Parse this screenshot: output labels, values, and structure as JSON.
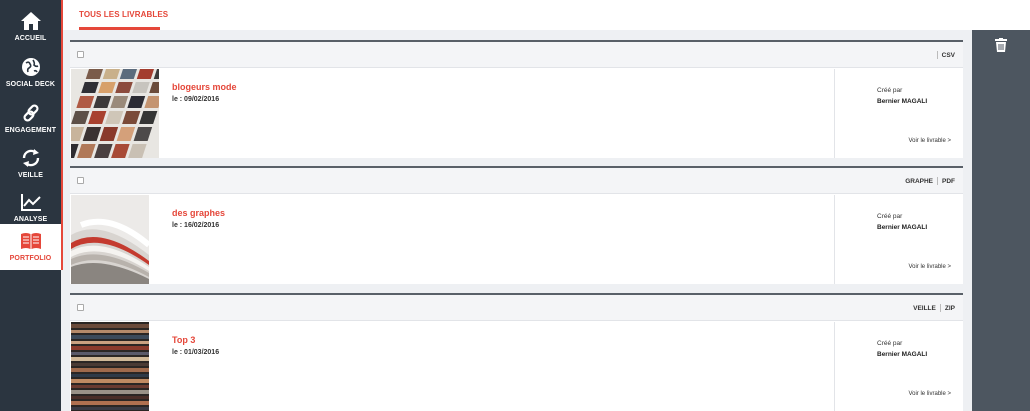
{
  "nav": {
    "items": [
      {
        "label": "ACCUEIL",
        "icon": "home-icon"
      },
      {
        "label": "SOCIAL DECK",
        "icon": "globe-icon"
      },
      {
        "label": "ENGAGEMENT",
        "icon": "link-icon"
      },
      {
        "label": "VEILLE",
        "icon": "refresh-icon"
      },
      {
        "label": "ANALYSE",
        "icon": "chart-icon"
      },
      {
        "label": "PORTFOLIO",
        "icon": "book-icon",
        "active": true
      }
    ]
  },
  "tabs": {
    "active_label": "TOUS LES LIVRABLES"
  },
  "colors": {
    "accent": "#e5473a",
    "sidebar": "#2b3540",
    "panel": "#4d5660"
  },
  "livrables": [
    {
      "title": "blogeurs mode",
      "date": "le : 09/02/2016",
      "tags": [
        "CSV"
      ],
      "created_label": "Créé par",
      "author": "Bernier MAGALI",
      "link": "Voir le livrable >",
      "thumb": "magazines-grid"
    },
    {
      "title": "des graphes",
      "date": "le : 16/02/2016",
      "tags": [
        "GRAPHE",
        "PDF"
      ],
      "created_label": "Créé par",
      "author": "Bernier MAGALI",
      "link": "Voir le livrable >",
      "thumb": "magazine-pages"
    },
    {
      "title": "Top 3",
      "date": "le : 01/03/2016",
      "tags": [
        "VEILLE",
        "ZIP"
      ],
      "created_label": "Créé par",
      "author": "Bernier MAGALI",
      "link": "Voir le livrable >",
      "thumb": "magazine-stack"
    }
  ]
}
